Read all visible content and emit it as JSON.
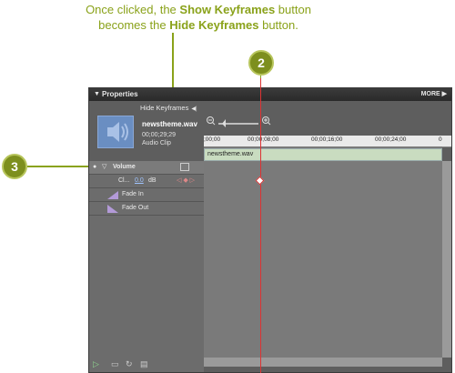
{
  "callout": {
    "line1": "Once clicked, the",
    "bold1": "Show Keyframes",
    "line1b": " button",
    "line2": "becomes the",
    "bold2": "Hide Keyframes",
    "line2b": " button."
  },
  "badges": {
    "two": "2",
    "three": "3"
  },
  "panel": {
    "title": "Properties",
    "more": "MORE",
    "hide_keyframes_label": "Hide Keyframes",
    "clip_name": "newstheme.wav",
    "clip_duration": "00;00;29;29",
    "clip_type": "Audio Clip",
    "ruler": [
      ";00;00",
      "00;00;08;00",
      "00;00;16;00",
      "00;00;24;00",
      "0"
    ],
    "track_clip": "newstheme.wav",
    "rows": {
      "volume": "Volume",
      "clip_label": "Cl...",
      "clip_value": "0.0",
      "clip_unit": "dB",
      "fade_in": "Fade In",
      "fade_out": "Fade Out"
    }
  },
  "colors": {
    "callout": "#8aa21a",
    "playhead": "#dd3333"
  }
}
